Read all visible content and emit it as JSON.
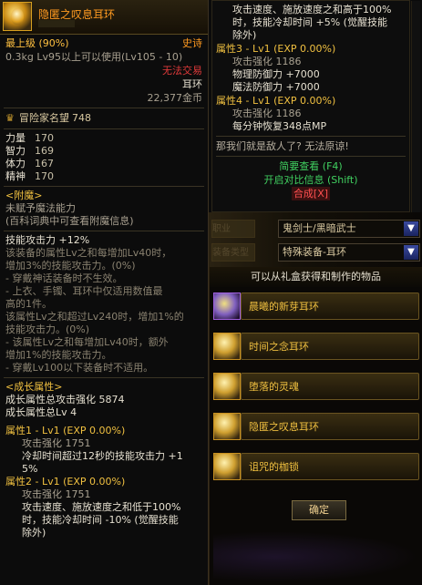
{
  "left": {
    "title": "隐匿之叹息耳环",
    "grade": "最上级 (90%)",
    "rarity": "史诗",
    "requirement": "0.3kg  Lv95以上可以使用(Lv105 - 10)",
    "trade": "无法交易",
    "type": "耳环",
    "price": "22,377金币",
    "fame_label": "冒险家名望",
    "fame_value": "748",
    "stats": [
      {
        "name": "力量",
        "value": "170"
      },
      {
        "name": "智力",
        "value": "169"
      },
      {
        "name": "体力",
        "value": "167"
      },
      {
        "name": "精神",
        "value": "170"
      }
    ],
    "enchant_title": "<附魔>",
    "enchant_lines": [
      "未赋予魔法能力",
      "(百科词典中可查看附魔信息)"
    ],
    "skill_header": "技能攻击力 +12%",
    "skill_desc": [
      "该装备的属性Lv之和每增加Lv40时，",
      "增加3%的技能攻击力。(0%)",
      "- 穿戴神话装备时不生效。",
      "- 上衣、手镯、耳环中仅适用数值最",
      "高的1件。",
      "该属性Lv之和超过Lv240时，增加1%的",
      "技能攻击力。(0%)",
      "- 该属性Lv之和每增加Lv40时，额外",
      "增加1%的技能攻击力。",
      "- 穿戴Lv100以下装备时不适用。"
    ],
    "growth_title": "<成长属性>",
    "growth_lines": [
      "成长属性总攻击强化 5874",
      "成长属性总Lv 4"
    ],
    "attr1_header": "属性1 - Lv1 (EXP 0.00%)",
    "attr1_lines": [
      "攻击强化 1751",
      "冷却时间超过12秒的技能攻击力 +1",
      "5%"
    ],
    "attr2_header": "属性2 - Lv1 (EXP 0.00%)",
    "attr2_lines": [
      "攻击强化 1751",
      "攻击速度、施放速度之和低于100%",
      "时，技能冷却时间 -10% (觉醒技能",
      "除外)"
    ]
  },
  "right_top": {
    "lines_top": [
      "攻击速度、施放速度之和高于100%",
      "时，技能冷却时间 +5% (觉醒技能",
      "除外)"
    ],
    "attr3_header": "属性3 - Lv1 (EXP 0.00%)",
    "attr3_lines": [
      "攻击强化 1186",
      "物理防御力 +7000",
      "魔法防御力 +7000"
    ],
    "attr4_header": "属性4 - Lv1 (EXP 0.00%)",
    "attr4_lines": [
      "攻击强化 1186",
      "每分钟恢复348点MP"
    ],
    "quote": "那我们就是敌人了? 无法原谅!",
    "link_brief": "简要查看 (F4)",
    "link_compare": "开启对比信息 (Shift)",
    "link_merge": "合成[X]"
  },
  "middle": {
    "label_job": "职业",
    "label_type": "装备类型",
    "job_value": "鬼剑士/黑暗武士",
    "type_value": "特殊装备-耳环"
  },
  "list": {
    "title": "可以从礼盒获得和制作的物品",
    "items": [
      {
        "label": "晨曦的新芽耳环"
      },
      {
        "label": "时间之念耳环"
      },
      {
        "label": "堕落的灵魂"
      },
      {
        "label": "隐匿之叹息耳环"
      },
      {
        "label": "诅咒的枷锁"
      }
    ],
    "confirm": "确定"
  }
}
